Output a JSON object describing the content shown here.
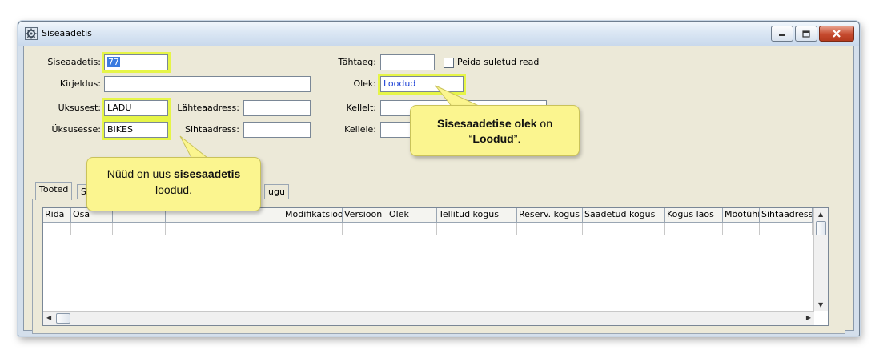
{
  "window": {
    "title": "Siseaadetis"
  },
  "form": {
    "siseaadetis": {
      "label": "Siseaadetis:",
      "value": "77"
    },
    "kirjeldus": {
      "label": "Kirjeldus:",
      "value": ""
    },
    "uksusest": {
      "label": "Üksusest:",
      "value": "LADU"
    },
    "uksusesse": {
      "label": "Üksusesse:",
      "value": "BIKES"
    },
    "lahteaadress": {
      "label": "Lähteaadress:",
      "value": ""
    },
    "sihtaadress": {
      "label": "Sihtaadress:",
      "value": ""
    },
    "tahtaeg": {
      "label": "Tähtaeg:",
      "value": ""
    },
    "peida": {
      "label": "Peida suletud read",
      "checked": false
    },
    "olek": {
      "label": "Olek:",
      "value": "Loodud"
    },
    "kellelt": {
      "label": "Kellelt:",
      "value": ""
    },
    "kellele": {
      "label": "Kellele:",
      "value": ""
    }
  },
  "tabs": [
    {
      "label": "Tooted"
    },
    {
      "label": "S"
    },
    {
      "label": "ugu"
    }
  ],
  "grid": {
    "columns": [
      "Rida",
      "Osa",
      "",
      "",
      "Modifikatsioon",
      "Versioon",
      "Olek",
      "Tellitud kogus",
      "Reserv. kogus",
      "Saadetud kogus",
      "Kogus laos",
      "Mõõtühik",
      "Sihtaadress"
    ]
  },
  "callouts": {
    "left": {
      "pre": "Nüüd on uus ",
      "bold": "sisesaadetis",
      "post": "loodud."
    },
    "right": {
      "bold1": "Sisesaadetise olek",
      "mid": " on",
      "q_open": "“",
      "bold2": "Loodud",
      "q_close": "”."
    }
  },
  "colors": {
    "highlight": "#e6f547",
    "callout": "#fbf58f",
    "olek_text": "#1a3fd6"
  }
}
